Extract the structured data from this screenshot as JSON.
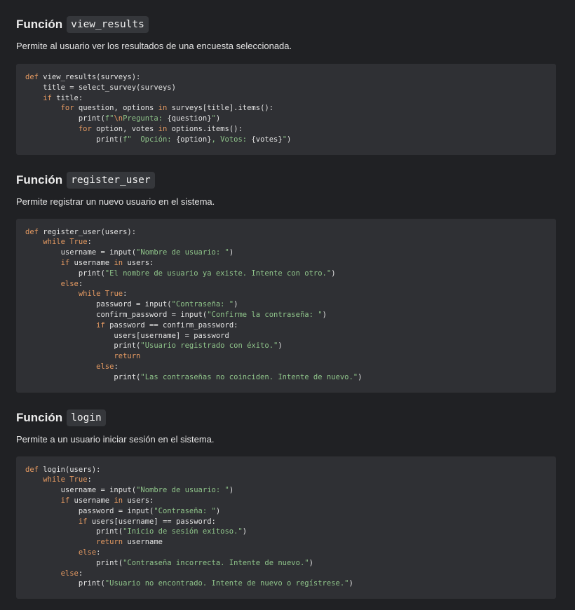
{
  "sections": [
    {
      "heading_prefix": "Función",
      "heading_code": "view_results",
      "description": "Permite al usuario ver los resultados de una encuesta seleccionada.",
      "code": [
        [
          [
            "kw",
            "def"
          ],
          [
            "t",
            " view_results(surveys):"
          ]
        ],
        [
          [
            "t",
            "    title = select_survey(surveys)"
          ]
        ],
        [
          [
            "t",
            "    "
          ],
          [
            "kw",
            "if"
          ],
          [
            "t",
            " title:"
          ]
        ],
        [
          [
            "t",
            "        "
          ],
          [
            "kw",
            "for"
          ],
          [
            "t",
            " question, options "
          ],
          [
            "kw",
            "in"
          ],
          [
            "t",
            " surveys[title].items():"
          ]
        ],
        [
          [
            "t",
            "            print("
          ],
          [
            "str",
            "f\""
          ],
          [
            "esc",
            "\\n"
          ],
          [
            "str",
            "Pregunta: "
          ],
          [
            "t",
            "{question}"
          ],
          [
            "str",
            "\""
          ],
          [
            "t",
            ")"
          ]
        ],
        [
          [
            "t",
            "            "
          ],
          [
            "kw",
            "for"
          ],
          [
            "t",
            " option, votes "
          ],
          [
            "kw",
            "in"
          ],
          [
            "t",
            " options.items():"
          ]
        ],
        [
          [
            "t",
            "                print("
          ],
          [
            "str",
            "f\"  Opción: "
          ],
          [
            "t",
            "{option}"
          ],
          [
            "str",
            ", Votos: "
          ],
          [
            "t",
            "{votes}"
          ],
          [
            "str",
            "\""
          ],
          [
            "t",
            ")"
          ]
        ]
      ]
    },
    {
      "heading_prefix": "Función",
      "heading_code": "register_user",
      "description": "Permite registrar un nuevo usuario en el sistema.",
      "code": [
        [
          [
            "kw",
            "def"
          ],
          [
            "t",
            " register_user(users):"
          ]
        ],
        [
          [
            "t",
            "    "
          ],
          [
            "kw",
            "while"
          ],
          [
            "t",
            " "
          ],
          [
            "kw",
            "True"
          ],
          [
            "t",
            ":"
          ]
        ],
        [
          [
            "t",
            "        username = input("
          ],
          [
            "str",
            "\"Nombre de usuario: \""
          ],
          [
            "t",
            ")"
          ]
        ],
        [
          [
            "t",
            "        "
          ],
          [
            "kw",
            "if"
          ],
          [
            "t",
            " username "
          ],
          [
            "kw",
            "in"
          ],
          [
            "t",
            " users:"
          ]
        ],
        [
          [
            "t",
            "            print("
          ],
          [
            "str",
            "\"El nombre de usuario ya existe. Intente con otro.\""
          ],
          [
            "t",
            ")"
          ]
        ],
        [
          [
            "t",
            "        "
          ],
          [
            "kw",
            "else"
          ],
          [
            "t",
            ":"
          ]
        ],
        [
          [
            "t",
            "            "
          ],
          [
            "kw",
            "while"
          ],
          [
            "t",
            " "
          ],
          [
            "kw",
            "True"
          ],
          [
            "t",
            ":"
          ]
        ],
        [
          [
            "t",
            "                password = input("
          ],
          [
            "str",
            "\"Contraseña: \""
          ],
          [
            "t",
            ")"
          ]
        ],
        [
          [
            "t",
            "                confirm_password = input("
          ],
          [
            "str",
            "\"Confirme la contraseña: \""
          ],
          [
            "t",
            ")"
          ]
        ],
        [
          [
            "t",
            "                "
          ],
          [
            "kw",
            "if"
          ],
          [
            "t",
            " password == confirm_password:"
          ]
        ],
        [
          [
            "t",
            "                    users[username] = password"
          ]
        ],
        [
          [
            "t",
            "                    print("
          ],
          [
            "str",
            "\"Usuario registrado con éxito.\""
          ],
          [
            "t",
            ")"
          ]
        ],
        [
          [
            "t",
            "                    "
          ],
          [
            "kw",
            "return"
          ]
        ],
        [
          [
            "t",
            "                "
          ],
          [
            "kw",
            "else"
          ],
          [
            "t",
            ":"
          ]
        ],
        [
          [
            "t",
            "                    print("
          ],
          [
            "str",
            "\"Las contraseñas no coinciden. Intente de nuevo.\""
          ],
          [
            "t",
            ")"
          ]
        ]
      ]
    },
    {
      "heading_prefix": "Función",
      "heading_code": "login",
      "description": "Permite a un usuario iniciar sesión en el sistema.",
      "code": [
        [
          [
            "kw",
            "def"
          ],
          [
            "t",
            " login(users):"
          ]
        ],
        [
          [
            "t",
            "    "
          ],
          [
            "kw",
            "while"
          ],
          [
            "t",
            " "
          ],
          [
            "kw",
            "True"
          ],
          [
            "t",
            ":"
          ]
        ],
        [
          [
            "t",
            "        username = input("
          ],
          [
            "str",
            "\"Nombre de usuario: \""
          ],
          [
            "t",
            ")"
          ]
        ],
        [
          [
            "t",
            "        "
          ],
          [
            "kw",
            "if"
          ],
          [
            "t",
            " username "
          ],
          [
            "kw",
            "in"
          ],
          [
            "t",
            " users:"
          ]
        ],
        [
          [
            "t",
            "            password = input("
          ],
          [
            "str",
            "\"Contraseña: \""
          ],
          [
            "t",
            ")"
          ]
        ],
        [
          [
            "t",
            "            "
          ],
          [
            "kw",
            "if"
          ],
          [
            "t",
            " users[username] == password:"
          ]
        ],
        [
          [
            "t",
            "                print("
          ],
          [
            "str",
            "\"Inicio de sesión exitoso.\""
          ],
          [
            "t",
            ")"
          ]
        ],
        [
          [
            "t",
            "                "
          ],
          [
            "kw",
            "return"
          ],
          [
            "t",
            " username"
          ]
        ],
        [
          [
            "t",
            "            "
          ],
          [
            "kw",
            "else"
          ],
          [
            "t",
            ":"
          ]
        ],
        [
          [
            "t",
            "                print("
          ],
          [
            "str",
            "\"Contraseña incorrecta. Intente de nuevo.\""
          ],
          [
            "t",
            ")"
          ]
        ],
        [
          [
            "t",
            "        "
          ],
          [
            "kw",
            "else"
          ],
          [
            "t",
            ":"
          ]
        ],
        [
          [
            "t",
            "            print("
          ],
          [
            "str",
            "\"Usuario no encontrado. Intente de nuevo o regístrese.\""
          ],
          [
            "t",
            ")"
          ]
        ]
      ]
    }
  ]
}
